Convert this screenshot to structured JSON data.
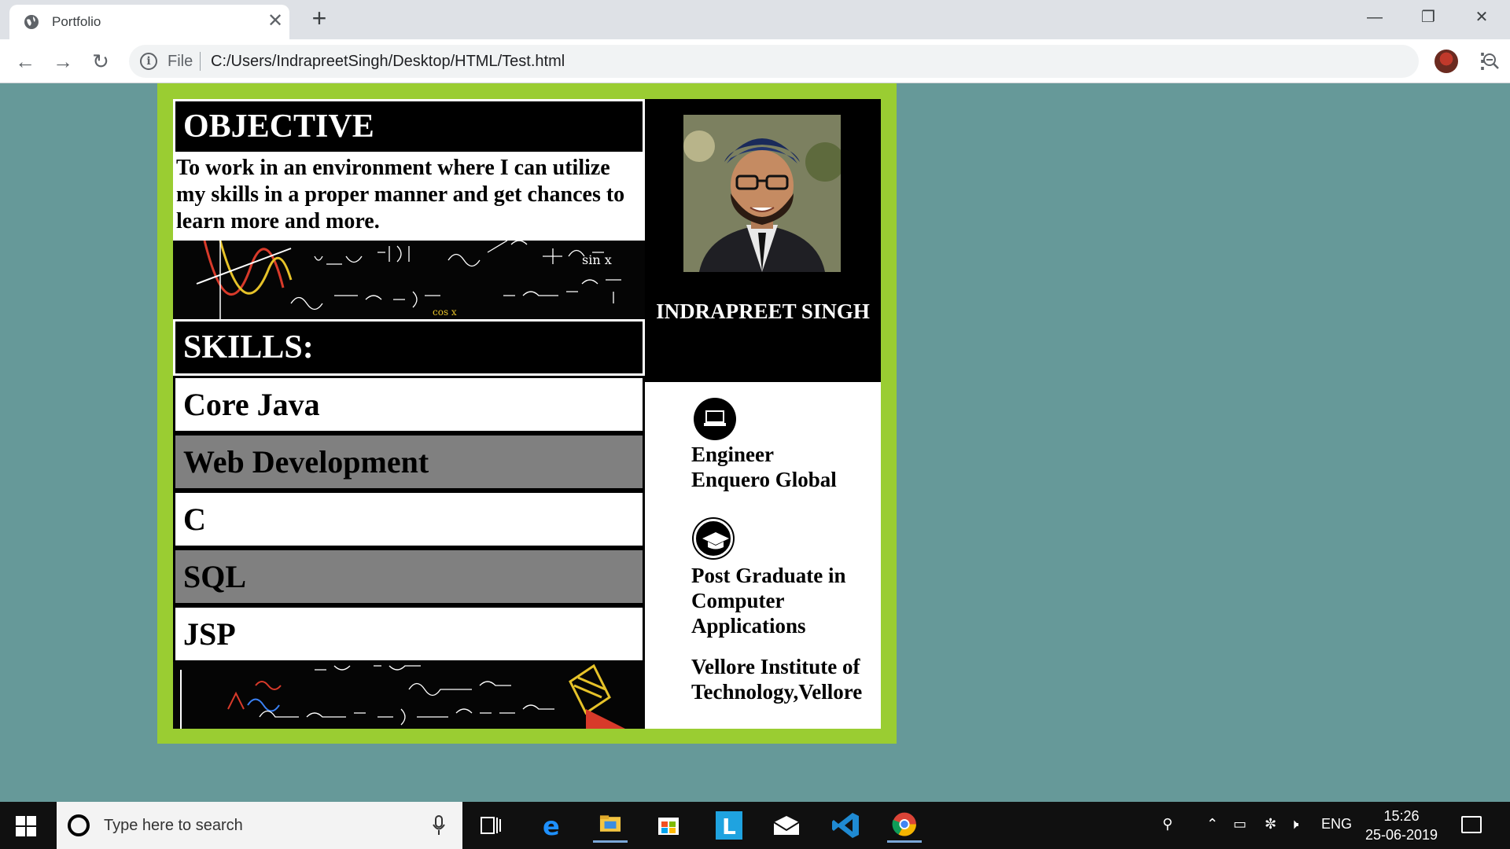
{
  "browser": {
    "tab_title": "Portfolio",
    "tab_close": "✕",
    "new_tab": "+",
    "scheme": "File",
    "url": "C:/Users/IndrapreetSingh/Desktop/HTML/Test.html",
    "window_controls": {
      "minimize": "—",
      "maximize": "❐",
      "close": "✕"
    },
    "nav": {
      "back": "←",
      "forward": "→",
      "reload": "↻"
    },
    "menu": "⋮",
    "star": "☆",
    "info": "i"
  },
  "resume": {
    "objective": {
      "heading": "OBJECTIVE",
      "text": "To work in an environment where I can utilize my skills in a proper manner and get chances to learn more and more."
    },
    "skills": {
      "heading": "SKILLS:",
      "items": [
        "Core Java",
        "Web Development",
        "C",
        "SQL",
        "JSP"
      ]
    },
    "name": "INDRAPREET SINGH",
    "job": {
      "title": "Engineer",
      "company": "Enquero Global"
    },
    "education": {
      "degree_line1": "Post Graduate in",
      "degree_line2": "Computer",
      "degree_line3": "Applications",
      "institute_line1": "Vellore Institute of",
      "institute_line2": "Technology,Vellore"
    },
    "colors": {
      "frame": "#9acd32",
      "background": "#669999",
      "gray_row": "#808080"
    }
  },
  "taskbar": {
    "search_placeholder": "Type here to search",
    "language": "ENG",
    "time": "15:26",
    "date": "25-06-2019"
  }
}
